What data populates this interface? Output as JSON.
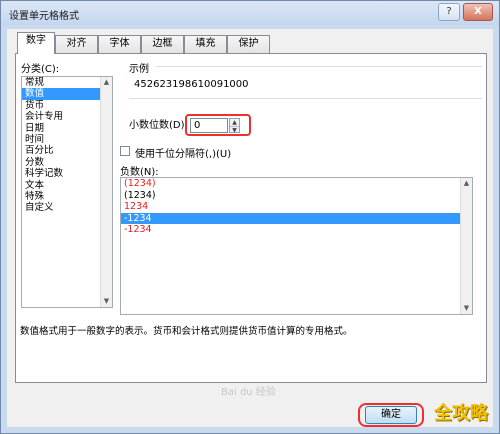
{
  "window": {
    "title": "设置单元格格式",
    "help_label": "?",
    "close_label": "X"
  },
  "tabs": [
    {
      "label": "数字"
    },
    {
      "label": "对齐"
    },
    {
      "label": "字体"
    },
    {
      "label": "边框"
    },
    {
      "label": "填充"
    },
    {
      "label": "保护"
    }
  ],
  "category": {
    "label": "分类(C):",
    "items": [
      "常规",
      "数值",
      "货币",
      "会计专用",
      "日期",
      "时间",
      "百分比",
      "分数",
      "科学记数",
      "文本",
      "特殊",
      "自定义"
    ],
    "selected": "数值"
  },
  "sample": {
    "label": "示例",
    "value": "452623198610091000"
  },
  "decimal": {
    "label": "小数位数(D):",
    "value": "0"
  },
  "thousands": {
    "label": "使用千位分隔符(,)(U)",
    "checked": false
  },
  "negative": {
    "label": "负数(N):",
    "items": [
      {
        "text": "(1234)",
        "color": "#e02020"
      },
      {
        "text": "(1234)",
        "color": "#000000"
      },
      {
        "text": "1234",
        "color": "#e02020"
      },
      {
        "text": "-1234",
        "color": "#000000",
        "selected": true
      },
      {
        "text": "-1234",
        "color": "#e02020"
      }
    ]
  },
  "description": "数值格式用于一般数字的表示。货币和会计格式则提供货币值计算的专用格式。",
  "buttons": {
    "ok_label": "确定"
  },
  "watermarks": {
    "baidu": "Bai du 经验",
    "site": "全攻略"
  },
  "colors": {
    "highlight": "#ef2f2f",
    "selection": "#3399ff",
    "negative_red": "#e02020"
  }
}
